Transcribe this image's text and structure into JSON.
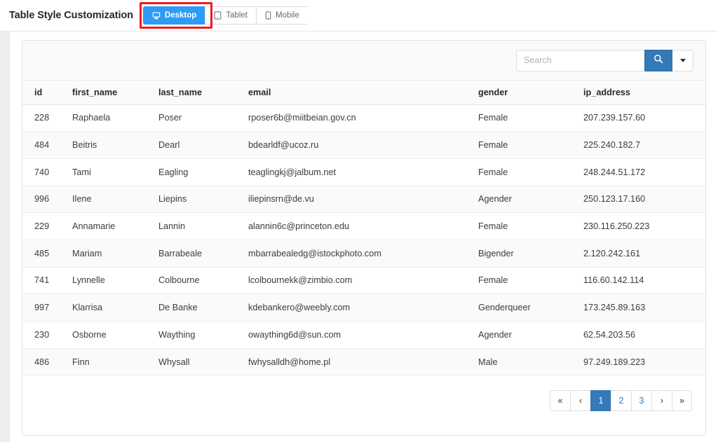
{
  "header": {
    "title": "Table Style Customization",
    "devices": [
      {
        "label": "Desktop",
        "icon": "desktop-icon",
        "active": true,
        "highlighted": true
      },
      {
        "label": "Tablet",
        "icon": "tablet-icon",
        "active": false,
        "highlighted": false
      },
      {
        "label": "Mobile",
        "icon": "mobile-icon",
        "active": false,
        "highlighted": false
      }
    ]
  },
  "toolbar": {
    "search_value": "",
    "search_placeholder": "Search",
    "search_button_icon": "search-icon",
    "search_dropdown_icon": "chevron-down-icon"
  },
  "table": {
    "columns": [
      "id",
      "first_name",
      "last_name",
      "email",
      "gender",
      "ip_address"
    ],
    "rows": [
      {
        "id": "228",
        "first_name": "Raphaela",
        "last_name": "Poser",
        "email": "rposer6b@miitbeian.gov.cn",
        "gender": "Female",
        "ip_address": "207.239.157.60"
      },
      {
        "id": "484",
        "first_name": "Beitris",
        "last_name": "Dearl",
        "email": "bdearldf@ucoz.ru",
        "gender": "Female",
        "ip_address": "225.240.182.7"
      },
      {
        "id": "740",
        "first_name": "Tami",
        "last_name": "Eagling",
        "email": "teaglingkj@jalbum.net",
        "gender": "Female",
        "ip_address": "248.244.51.172"
      },
      {
        "id": "996",
        "first_name": "Ilene",
        "last_name": "Liepins",
        "email": "iliepinsrn@de.vu",
        "gender": "Agender",
        "ip_address": "250.123.17.160"
      },
      {
        "id": "229",
        "first_name": "Annamarie",
        "last_name": "Lannin",
        "email": "alannin6c@princeton.edu",
        "gender": "Female",
        "ip_address": "230.116.250.223"
      },
      {
        "id": "485",
        "first_name": "Mariam",
        "last_name": "Barrabeale",
        "email": "mbarrabealedg@istockphoto.com",
        "gender": "Bigender",
        "ip_address": "2.120.242.161"
      },
      {
        "id": "741",
        "first_name": "Lynnelle",
        "last_name": "Colbourne",
        "email": "lcolbournekk@zimbio.com",
        "gender": "Female",
        "ip_address": "116.60.142.114"
      },
      {
        "id": "997",
        "first_name": "Klarrisa",
        "last_name": "De Banke",
        "email": "kdebankero@weebly.com",
        "gender": "Genderqueer",
        "ip_address": "173.245.89.163"
      },
      {
        "id": "230",
        "first_name": "Osborne",
        "last_name": "Waything",
        "email": "owaything6d@sun.com",
        "gender": "Agender",
        "ip_address": "62.54.203.56"
      },
      {
        "id": "486",
        "first_name": "Finn",
        "last_name": "Whysall",
        "email": "fwhysalldh@home.pl",
        "gender": "Male",
        "ip_address": "97.249.189.223"
      }
    ]
  },
  "pagination": {
    "items": [
      {
        "label": "«",
        "type": "first",
        "active": false
      },
      {
        "label": "‹",
        "type": "prev",
        "active": false
      },
      {
        "label": "1",
        "type": "page",
        "active": true
      },
      {
        "label": "2",
        "type": "page",
        "active": false
      },
      {
        "label": "3",
        "type": "page",
        "active": false
      },
      {
        "label": "›",
        "type": "next",
        "active": false
      },
      {
        "label": "»",
        "type": "last",
        "active": false
      }
    ]
  },
  "colors": {
    "active_device": "#2e9bf4",
    "primary": "#337ab7",
    "highlight_box": "#f91717",
    "page_background": "#ededed"
  }
}
